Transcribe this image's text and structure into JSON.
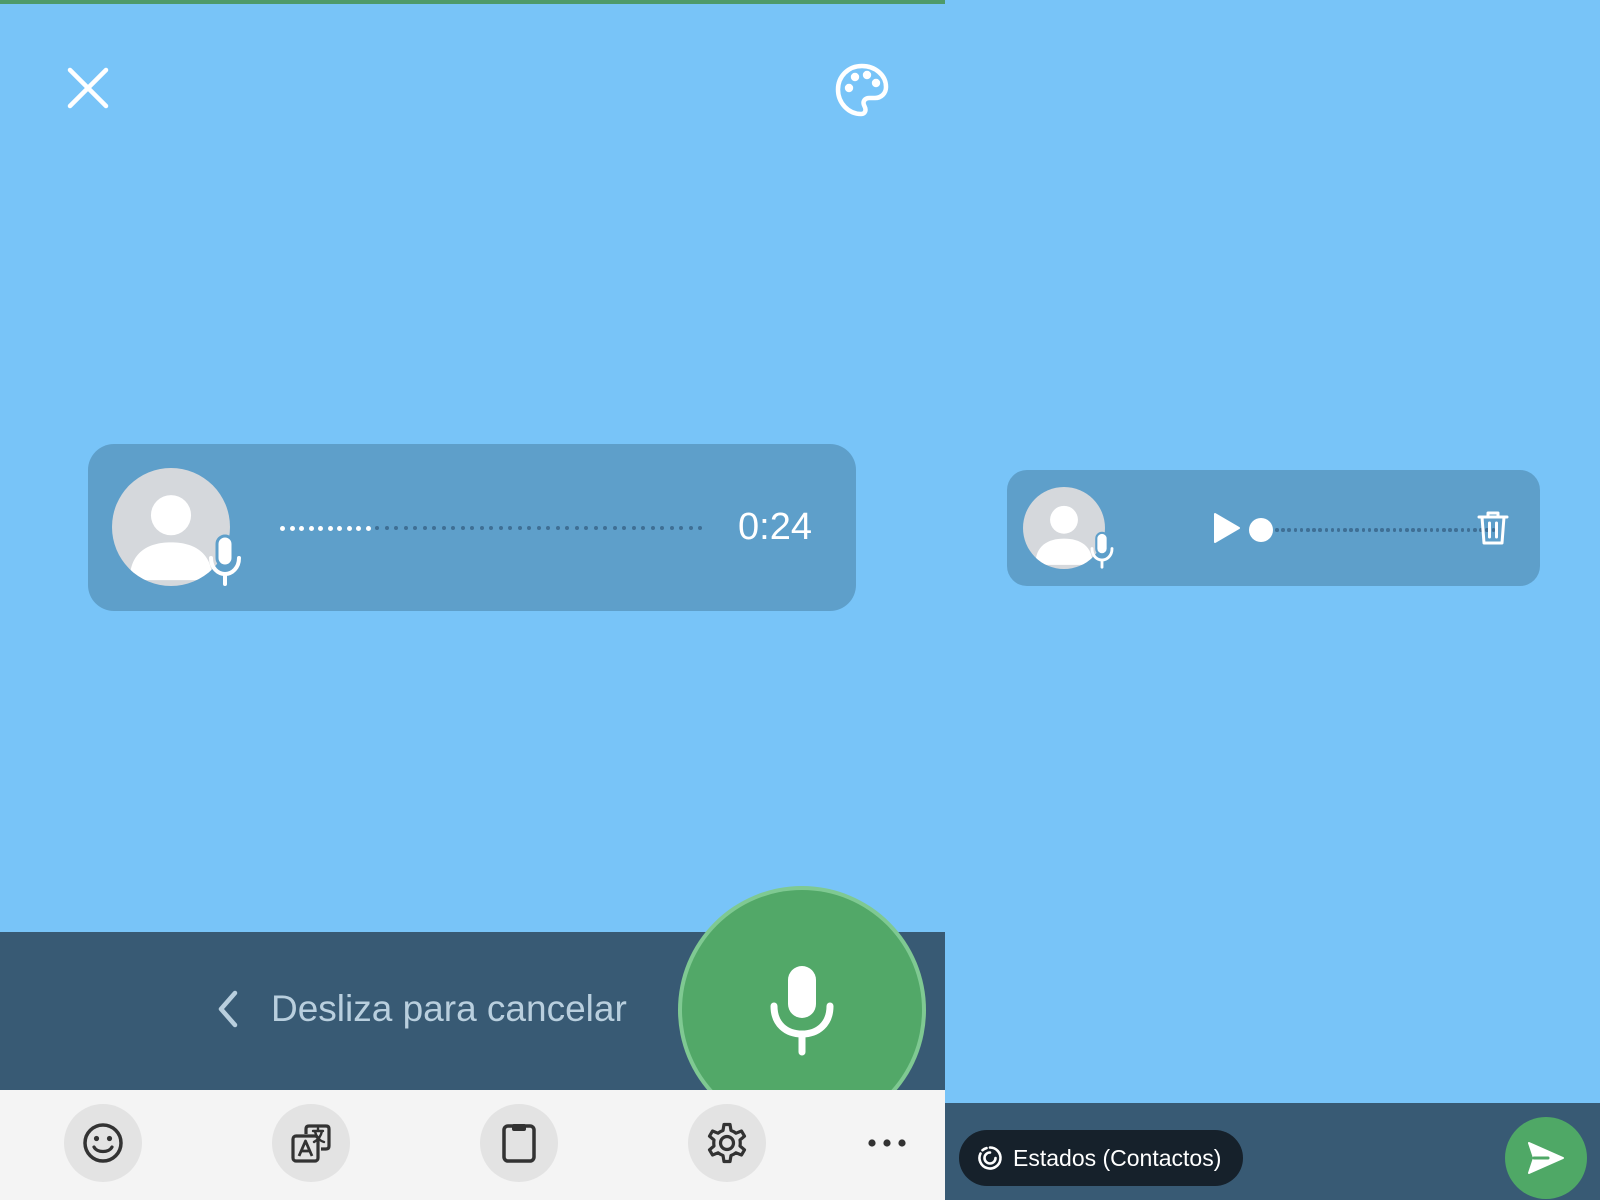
{
  "recording_screen": {
    "top_bar": {
      "close_icon": "close-icon",
      "palette_icon": "palette-icon"
    },
    "voice_bubble": {
      "avatar_icon": "person-avatar-icon",
      "badge_icon": "microphone-icon",
      "duration": "0:24",
      "progress": 0.22
    },
    "record_bar": {
      "slide_hint": "Desliza para cancelar",
      "chevron_icon": "chevron-left-icon",
      "record_icon": "microphone-icon"
    },
    "keyboard_toolbar": {
      "items": [
        {
          "name": "emoji",
          "icon": "emoji-icon"
        },
        {
          "name": "translate",
          "icon": "translate-icon"
        },
        {
          "name": "clipboard",
          "icon": "clipboard-icon"
        },
        {
          "name": "settings",
          "icon": "gear-icon"
        },
        {
          "name": "more",
          "icon": "more-horizontal-icon"
        }
      ]
    }
  },
  "preview_screen": {
    "voice_bubble": {
      "avatar_icon": "person-avatar-icon",
      "badge_icon": "microphone-icon",
      "play_icon": "play-icon",
      "delete_icon": "trash-icon",
      "progress": 0.0
    },
    "bottom_bar": {
      "audience_label": "Estados (Contactos)",
      "audience_icon": "status-ring-icon",
      "send_icon": "send-icon"
    }
  },
  "colors": {
    "background": "#78C4F8",
    "bubble": "#5E9FCA",
    "bar": "#385A74",
    "accent_green": "#52A868",
    "pill": "#16212B",
    "keyboard": "#F4F4F4"
  }
}
